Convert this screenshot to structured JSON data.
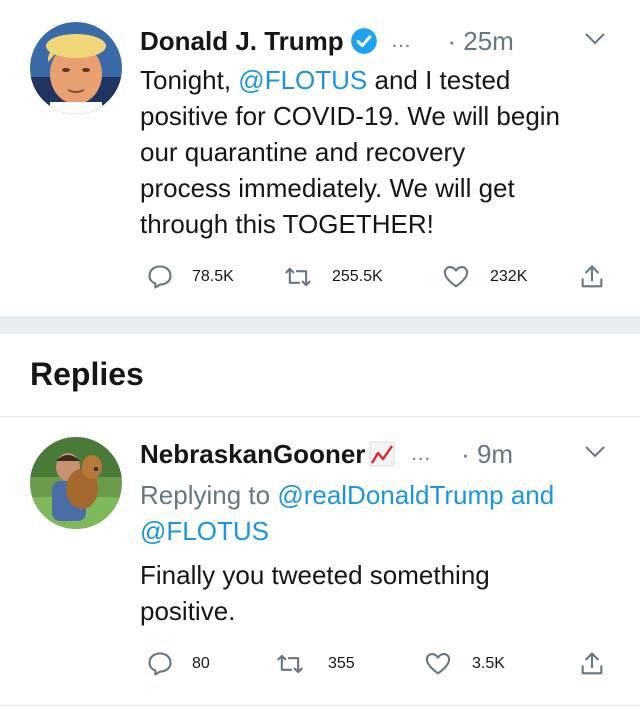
{
  "main_tweet": {
    "author_name": "Donald J. Trump",
    "more": "...",
    "time": "· 25m",
    "text_lines": [
      {
        "pre": "Tonight, ",
        "mention": "@FLOTUS",
        "post": " and I tested"
      },
      {
        "pre": "positive for COVID-19. We will begin"
      },
      {
        "pre": "our quarantine and recovery"
      },
      {
        "pre": "process immediately. We will get"
      },
      {
        "pre": "through this TOGETHER!"
      }
    ],
    "replies_count": "78.5K",
    "retweets_count": "255.5K",
    "likes_count": "232K"
  },
  "section": {
    "replies_title": "Replies"
  },
  "reply": {
    "author_name": "NebraskanGooner",
    "more": "...",
    "time": "· 9m",
    "replying_prefix": "Replying to ",
    "replying_mention_1": "@realDonaldTrump",
    "replying_and": " and",
    "replying_mention_2": "@FLOTUS",
    "text_lines": [
      "Finally you tweeted something",
      "positive."
    ],
    "replies_count": "80",
    "retweets_count": "355",
    "likes_count": "3.5K"
  },
  "colors": {
    "link": "#1b95e0",
    "muted": "#657786",
    "verified": "#1da1f2",
    "separator": "#e6ecf0"
  },
  "icons": [
    "verified-badge-icon",
    "chevron-down-icon",
    "reply-icon",
    "retweet-icon",
    "like-icon",
    "share-icon",
    "trending-chart-icon"
  ]
}
